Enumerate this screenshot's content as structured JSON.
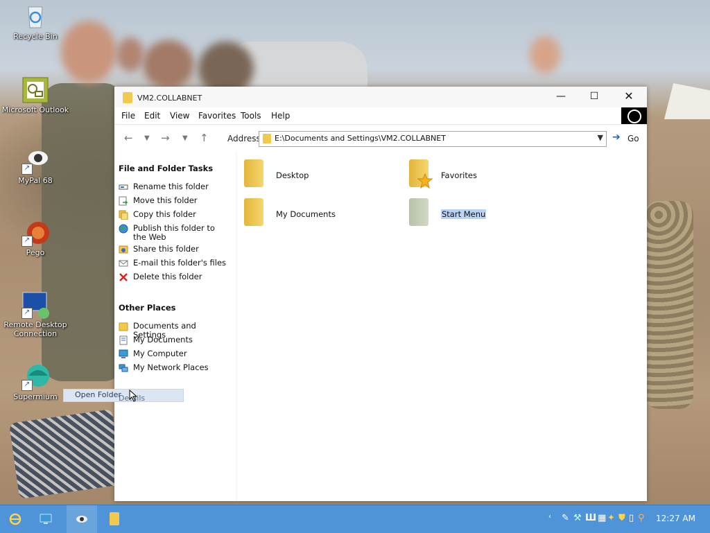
{
  "desktop": {
    "icons": [
      {
        "label": "Recycle Bin"
      },
      {
        "label": "Microsoft Outlook"
      },
      {
        "label": "MyPal 68"
      },
      {
        "label": "Pego"
      },
      {
        "label": "Remote Desktop Connection"
      },
      {
        "label": "Supermium"
      }
    ]
  },
  "window": {
    "title": "VM2.COLLABNET",
    "menu": [
      "File",
      "Edit",
      "View",
      "Favorites",
      "Tools",
      "Help"
    ],
    "address_label": "Address",
    "address_value": "E:\\Documents and Settings\\VM2.COLLABNET",
    "go_label": "Go",
    "left_pane": {
      "file_folder_tasks_title": "File and Folder Tasks",
      "tasks": [
        "Rename this folder",
        "Move this folder",
        "Copy this folder",
        "Publish this folder to the Web",
        "Share this folder",
        "E-mail this folder's files",
        "Delete this folder"
      ],
      "other_places_title": "Other Places",
      "places": [
        "Documents and Settings",
        "My Documents",
        "My Computer",
        "My Network Places"
      ],
      "details_title": "Details"
    },
    "items": [
      {
        "label": "Desktop"
      },
      {
        "label": "Favorites"
      },
      {
        "label": "My Documents"
      },
      {
        "label": "Start Menu",
        "selected": true
      }
    ],
    "context_hint": "Open Folder"
  },
  "taskbar": {
    "clock": "12:27 AM"
  },
  "colors": {
    "taskbar": "#4f93d8",
    "folder": "#f2c94c",
    "selection": "#b9d3f5"
  }
}
